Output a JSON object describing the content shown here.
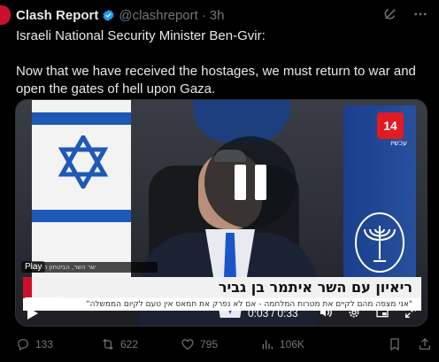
{
  "author": {
    "avatar_initial": "",
    "name": "Clash Report",
    "handle": "@clashreport",
    "separator": "·",
    "time": "3h"
  },
  "tweet": {
    "line1": "Israeli National Security Minister Ben-Gvir:",
    "line2": "Now that we have received the hostages, we must return to war and open the gates of hell upon Gaza."
  },
  "video": {
    "channel_number": "14",
    "channel_sub": "עכשיו",
    "play_badge": "Play",
    "ticker_small": "שר השר, הביטחון הלאומי",
    "caption_main": "ריאיון עם השר איתמר בן גביר",
    "caption_sub": "\"אני מצפה מהם לקיים את מטרות המלחמה - אם לא נפרק את חמאס אין טעם לקיום הממשלה\"",
    "time": "0:03 / 0:33",
    "progress_fraction": 0.09,
    "state": "paused"
  },
  "actions": {
    "replies": "133",
    "retweets": "622",
    "likes": "795",
    "views": "106K"
  },
  "icons": {
    "verified": "verified-badge-icon",
    "grok": "grok-icon",
    "more": "more-icon",
    "reply": "reply-icon",
    "retweet": "retweet-icon",
    "like": "heart-icon",
    "views": "views-icon",
    "bookmark": "bookmark-icon",
    "share": "share-icon"
  },
  "colors": {
    "background": "#000000",
    "text": "#e7e9ea",
    "muted": "#71767b",
    "verified": "#1d9bf0",
    "brand_red": "#c8102e"
  }
}
